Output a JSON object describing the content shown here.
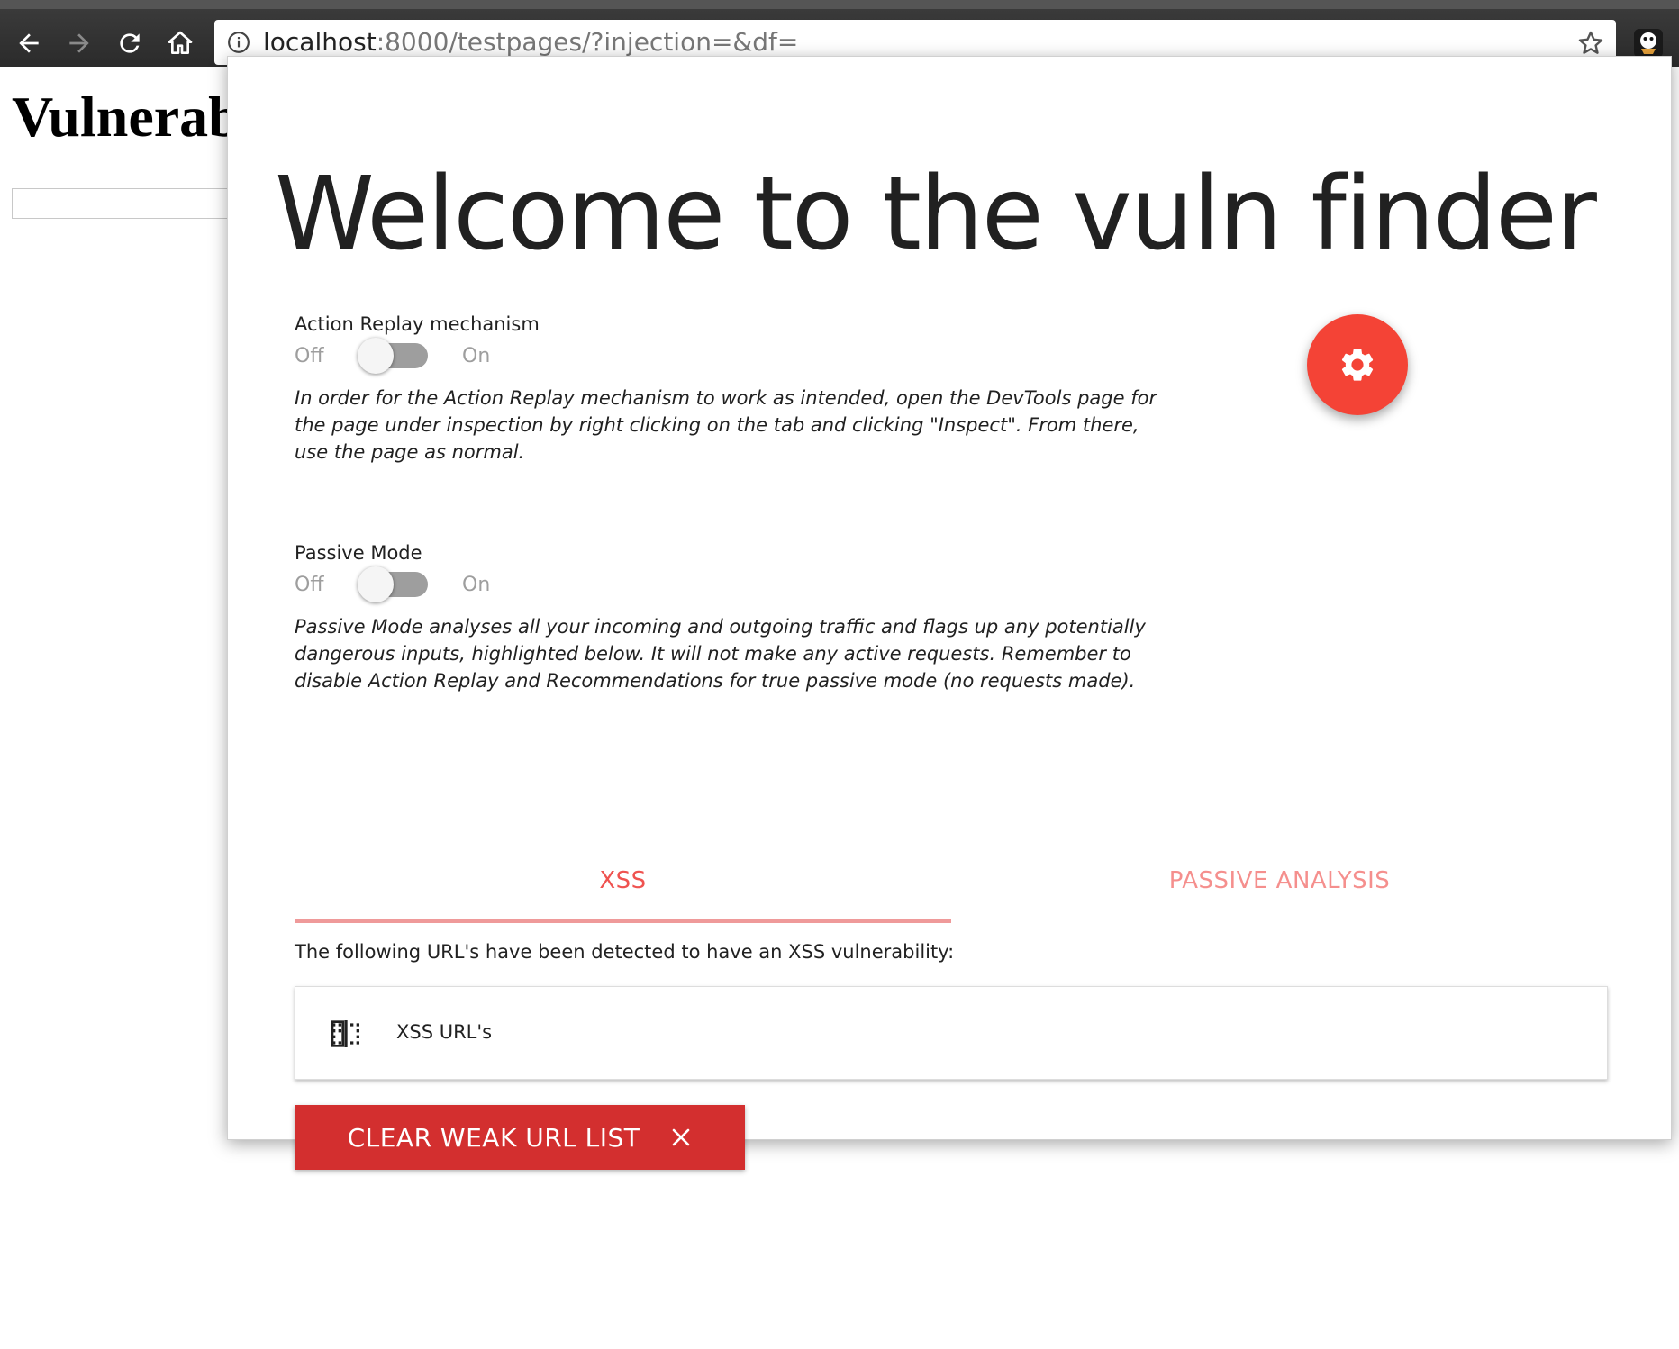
{
  "browser": {
    "url_host": "localhost",
    "url_rest": ":8000/testpages/?injection=&df="
  },
  "page": {
    "heading": "Vulnerab"
  },
  "popup": {
    "title": "Welcome to the vuln finder",
    "action_replay": {
      "label": "Action Replay mechanism",
      "off": "Off",
      "on": "On",
      "checked": false,
      "description": "In order for the Action Replay mechanism to work as intended, open the DevTools page for the page under inspection by right clicking on the tab and clicking \"Inspect\". From there, use the page as normal."
    },
    "passive_mode": {
      "label": "Passive Mode",
      "off": "Off",
      "on": "On",
      "checked": false,
      "description": "Passive Mode analyses all your incoming and outgoing traffic and flags up any potentially dangerous inputs, highlighted below. It will not make any active requests. Remember to disable Action Replay and Recommendations for true passive mode (no requests made)."
    },
    "tabs": [
      {
        "label": "XSS",
        "active": true
      },
      {
        "label": "PASSIVE ANALYSIS",
        "active": false
      }
    ],
    "xss_intro": "The following URL's have been detected to have an XSS vulnerability:",
    "xss_list_title": "XSS URL's",
    "clear_button": "CLEAR WEAK URL LIST"
  },
  "colors": {
    "accent": "#f44336",
    "tab_text": "#ef5350",
    "button": "#d32f2f",
    "toolbar": "#2b2b2b"
  },
  "icons": [
    "back-arrow-icon",
    "forward-arrow-icon",
    "reload-icon",
    "home-icon",
    "info-icon",
    "star-icon",
    "extension-icon",
    "gear-icon",
    "vertical-split-icon",
    "close-icon"
  ]
}
